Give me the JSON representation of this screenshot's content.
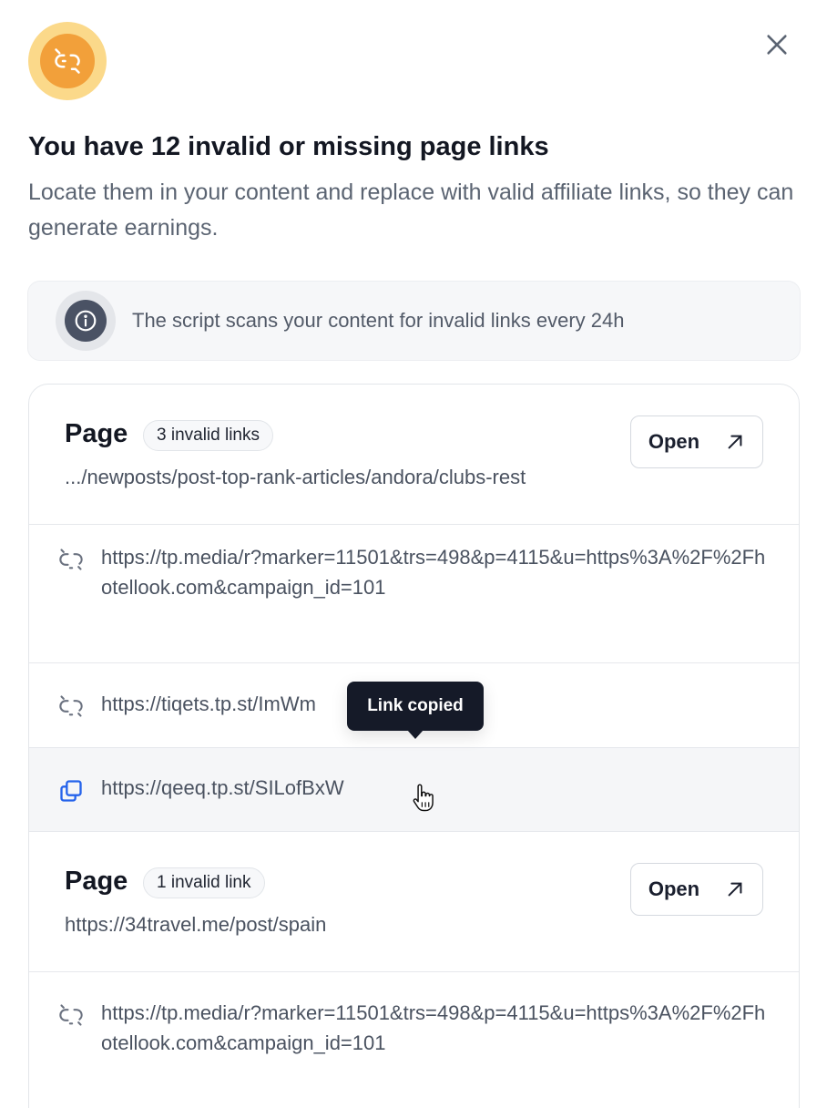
{
  "header": {
    "icon": "broken-link-icon",
    "title": "You have 12 invalid or missing page links",
    "subtitle": "Locate them in your content and replace with valid affiliate links, so they can generate earnings."
  },
  "info": {
    "icon": "info-icon",
    "text": "The script scans your content for invalid links every 24h"
  },
  "pages": [
    {
      "label": "Page",
      "badge": "3 invalid links",
      "url": ".../newposts/post-top-rank-articles/andora/clubs-rest",
      "open_label": "Open",
      "links": [
        "https://tp.media/r?marker=11501&trs=498&p=4115&u=https%3A%2F%2Fhotellook.com&campaign_id=101",
        "https://tiqets.tp.st/ImWm",
        "https://qeeq.tp.st/SILofBxW"
      ]
    },
    {
      "label": "Page",
      "badge": "1 invalid link",
      "url": "https://34travel.me/post/spain",
      "open_label": "Open",
      "links": [
        "https://tp.media/r?marker=11501&trs=498&p=4115&u=https%3A%2F%2Fhotellook.com&campaign_id=101"
      ]
    }
  ],
  "tooltip": "Link copied",
  "colors": {
    "accent_orange": "#f2a03a",
    "accent_orange_light": "#fbd98a",
    "copy_blue": "#2563eb",
    "tooltip_bg": "#151a28"
  }
}
